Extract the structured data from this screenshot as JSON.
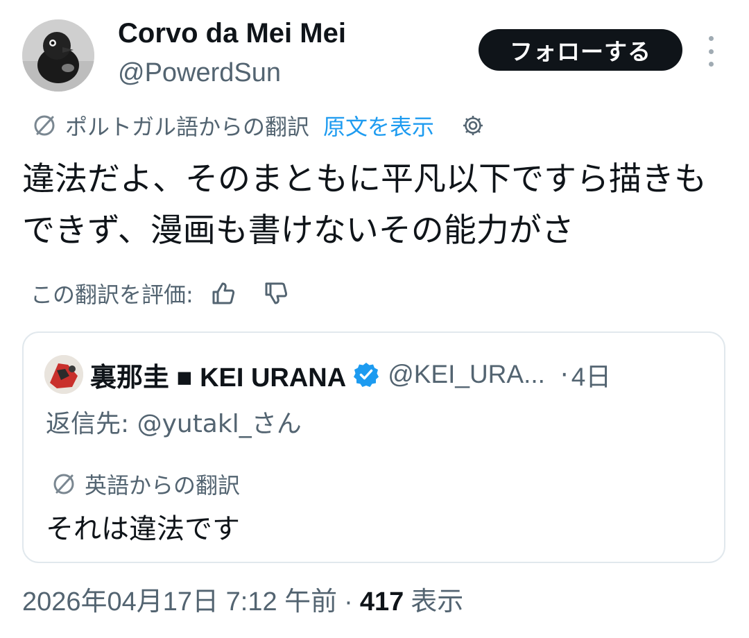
{
  "tweet": {
    "author": {
      "display_name": "Corvo da Mei Mei",
      "handle": "@PowerdSun"
    },
    "follow_label": "フォローする",
    "translation": {
      "notice": "ポルトガル語からの翻訳",
      "show_original": "原文を表示"
    },
    "text": "違法だよ、そのまともに平凡以下ですら描きもできず、漫画も書けないその能力がさ",
    "rate": {
      "label": "この翻訳を評価:"
    },
    "quoted": {
      "display_name": "裏那圭 ■ KEI URANA",
      "handle": "@KEI_URA...",
      "separator": "·",
      "time": "4日",
      "reply_to": "返信先: @yutakl_さん",
      "translation_notice": "英語からの翻訳",
      "text": "それは違法です"
    },
    "meta": {
      "timestamp": "2026年04月17日 7:12 午前",
      "separator": "·",
      "views_count": "417",
      "views_label": "表示"
    }
  },
  "colors": {
    "text": "#0f1419",
    "secondary": "#536471",
    "link": "#1d9bf0",
    "follow_bg": "#0f1419",
    "border": "#e1e8ed",
    "verified": "#1d9bf0"
  },
  "icons": {
    "translate": "translate-icon",
    "settings": "gear-icon",
    "thumbs_up": "thumbs-up-icon",
    "thumbs_down": "thumbs-down-icon",
    "verified": "verified-badge-icon",
    "more": "more-icon"
  }
}
